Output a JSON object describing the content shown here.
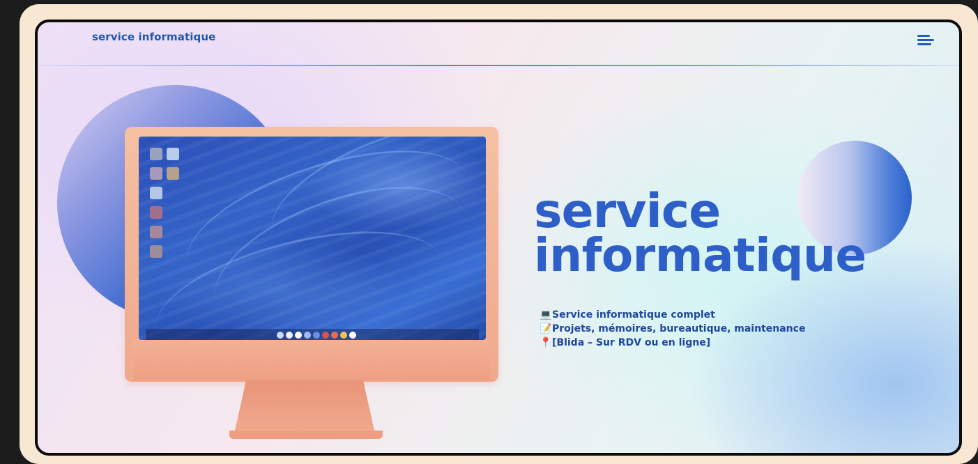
{
  "nav": {
    "brand": "service informatique",
    "menu_icon": "hamburger-menu-icon"
  },
  "hero": {
    "title_line1": "service",
    "title_line2": "informatique",
    "features": [
      {
        "icon": "💻",
        "icon_name": "laptop-icon",
        "text": "Service informatique complet"
      },
      {
        "icon": "📝",
        "icon_name": "memo-icon",
        "text": "Projets, mémoires, bureautique, maintenance"
      },
      {
        "icon": "📍",
        "icon_name": "pin-icon",
        "text": "[Blida – Sur RDV ou en ligne]"
      }
    ]
  },
  "colors": {
    "accent": "#2e5fc8",
    "brand_text": "#2058ae",
    "monitor": "#f1a88c",
    "frame_bg": "#f8e8d3"
  }
}
